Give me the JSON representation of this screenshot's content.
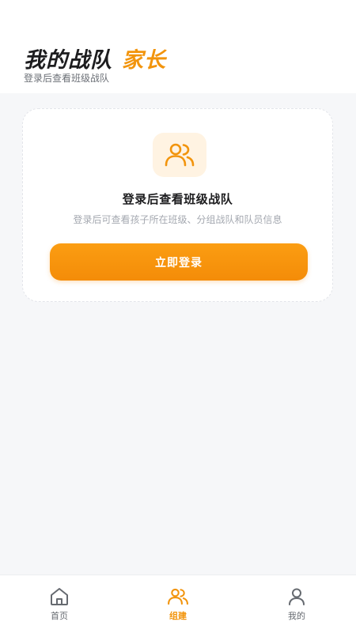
{
  "header": {
    "title": "我的战队",
    "role": "家长",
    "subtitle": "登录后查看班级战队"
  },
  "card": {
    "icon": "team-icon",
    "title": "登录后查看班级战队",
    "description": "登录后可查看孩子所在班级、分组战队和队员信息",
    "button_label": "立即登录"
  },
  "tabbar": {
    "tabs": [
      {
        "label": "首页",
        "icon": "home-icon",
        "active": false
      },
      {
        "label": "组建",
        "icon": "team-icon",
        "active": true
      },
      {
        "label": "我的",
        "icon": "user-icon",
        "active": false
      }
    ]
  },
  "colors": {
    "accent": "#f2940c",
    "button": "#f89510",
    "icon_bg": "#fff3e2",
    "text_primary": "#1d1d1f",
    "text_secondary": "#a4a8b0"
  }
}
